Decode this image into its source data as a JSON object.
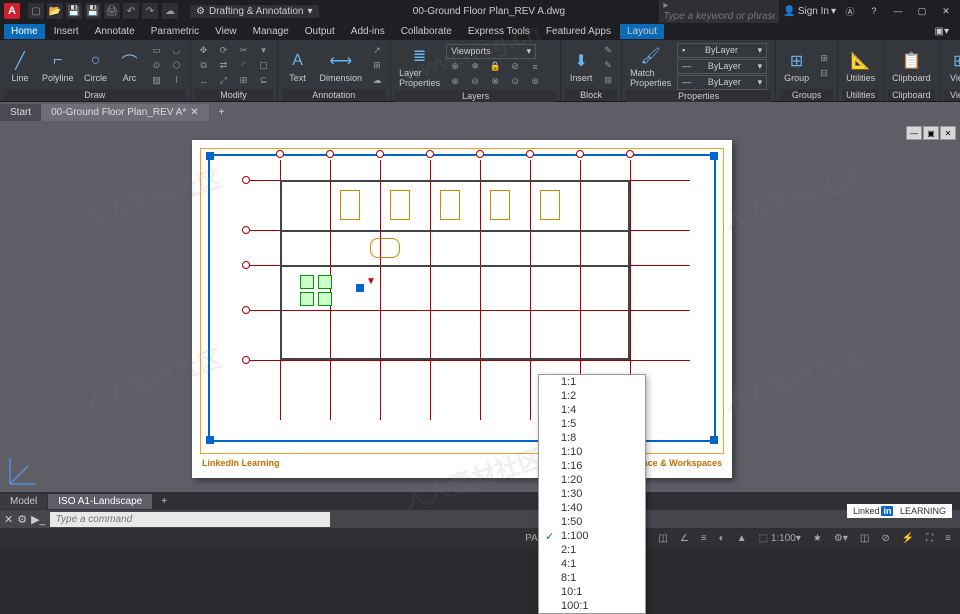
{
  "title": {
    "workspace": "Drafting & Annotation",
    "filename": "00-Ground Floor Plan_REV A.dwg",
    "sign_in": "Sign In",
    "search_placeholder": "Type a keyword or phrase"
  },
  "menu": {
    "items": [
      "Home",
      "Insert",
      "Annotate",
      "Parametric",
      "View",
      "Manage",
      "Output",
      "Add-ins",
      "Collaborate",
      "Express Tools",
      "Featured Apps",
      "Layout"
    ],
    "active": "Home"
  },
  "ribbon": {
    "draw": {
      "label": "Draw",
      "line": "Line",
      "polyline": "Polyline",
      "circle": "Circle",
      "arc": "Arc"
    },
    "modify": {
      "label": "Modify"
    },
    "annotation": {
      "label": "Annotation",
      "text": "Text",
      "dim": "Dimension"
    },
    "layers": {
      "label": "Layers",
      "props": "Layer\nProperties",
      "viewports": "Viewports"
    },
    "block": {
      "label": "Block",
      "insert": "Insert"
    },
    "properties": {
      "label": "Properties",
      "match": "Match\nProperties",
      "bylayer": "ByLayer",
      "bylayer2": "ByLayer",
      "bylayer3": "ByLayer"
    },
    "groups": {
      "label": "Groups",
      "group": "Group"
    },
    "utilities": {
      "label": "Utilities"
    },
    "clipboard": {
      "label": "Clipboard"
    },
    "view": {
      "label": "View"
    }
  },
  "filetabs": {
    "start": "Start",
    "active": "00-Ground Floor Plan_REV A*"
  },
  "scale_list": {
    "items": [
      "1:1",
      "1:2",
      "1:4",
      "1:5",
      "1:8",
      "1:10",
      "1:16",
      "1:20",
      "1:30",
      "1:40",
      "1:50",
      "1:100",
      "2:1",
      "4:1",
      "8:1",
      "10:1",
      "100:1"
    ],
    "selected": "1:100"
  },
  "title_block": {
    "left": "LinkedIn Learning",
    "right": "AutoCAD: Space & Workspaces"
  },
  "layout_tabs": {
    "model": "Model",
    "active": "ISO A1-Landscape"
  },
  "command": {
    "placeholder": "Type a command"
  },
  "status": {
    "space": "PAPER",
    "scale": "1:100"
  },
  "linkedin": {
    "text": "LEARNING",
    "brand": "in"
  }
}
